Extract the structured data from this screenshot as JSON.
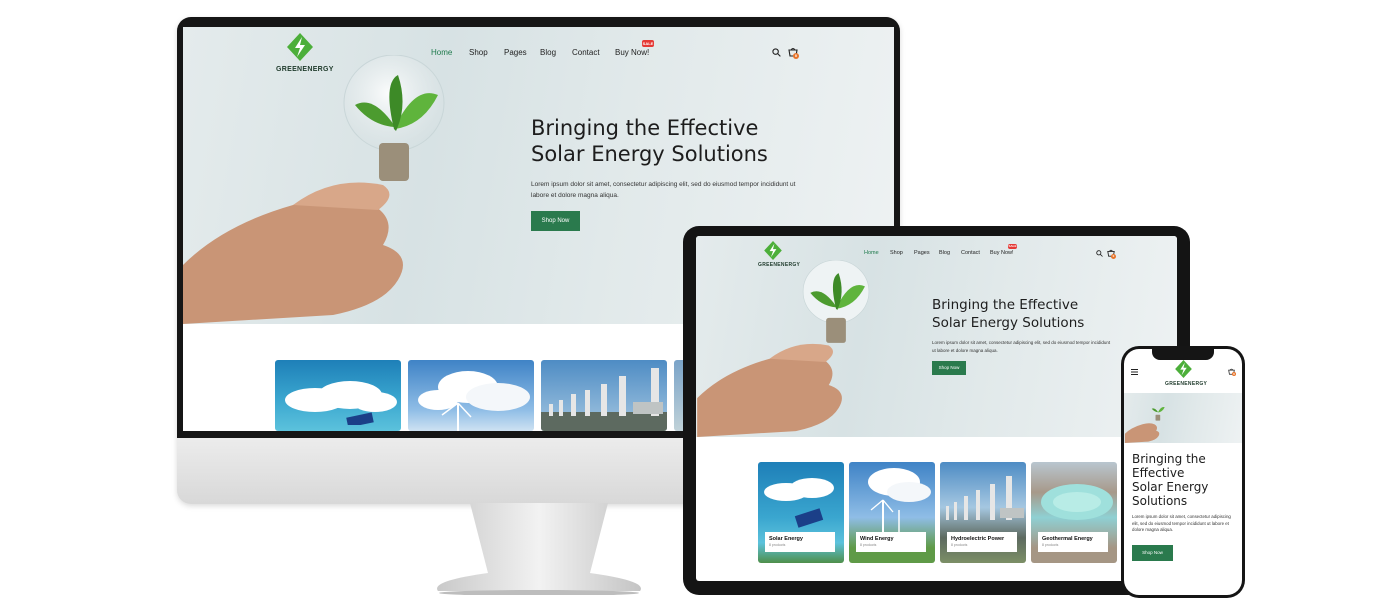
{
  "site": {
    "brand": "GREENENERGY",
    "nav": [
      "Home",
      "Shop",
      "Pages",
      "Blog",
      "Contact",
      "Buy Now!"
    ],
    "sale_badge": "SALE",
    "cart_count": "0",
    "hero_title": "Bringing the Effective\nSolar Energy Solutions",
    "hero_title_phone": "Bringing the\nEffective\nSolar Energy\nSolutions",
    "hero_text": "Lorem ipsum dolor sit amet, consectetur adipiscing elit, sed do eiusmod tempor incididunt ut labore et dolore magna aliqua.",
    "cta_label": "Shop Now",
    "categories": [
      {
        "title": "Solar Energy",
        "count": "8 products"
      },
      {
        "title": "Wind Energy",
        "count": "8 products"
      },
      {
        "title": "Hydroelectric Power",
        "count": "8 products"
      },
      {
        "title": "Geothermal Energy",
        "count": "8 products"
      }
    ]
  },
  "colors": {
    "accent": "#2a7a4d",
    "logo_green": "#4caf3a",
    "sale_red": "#e53935",
    "cart_orange": "#e8742a"
  },
  "icons": [
    "lightning-logo-icon",
    "search-icon",
    "cart-icon",
    "hamburger-menu-icon"
  ]
}
